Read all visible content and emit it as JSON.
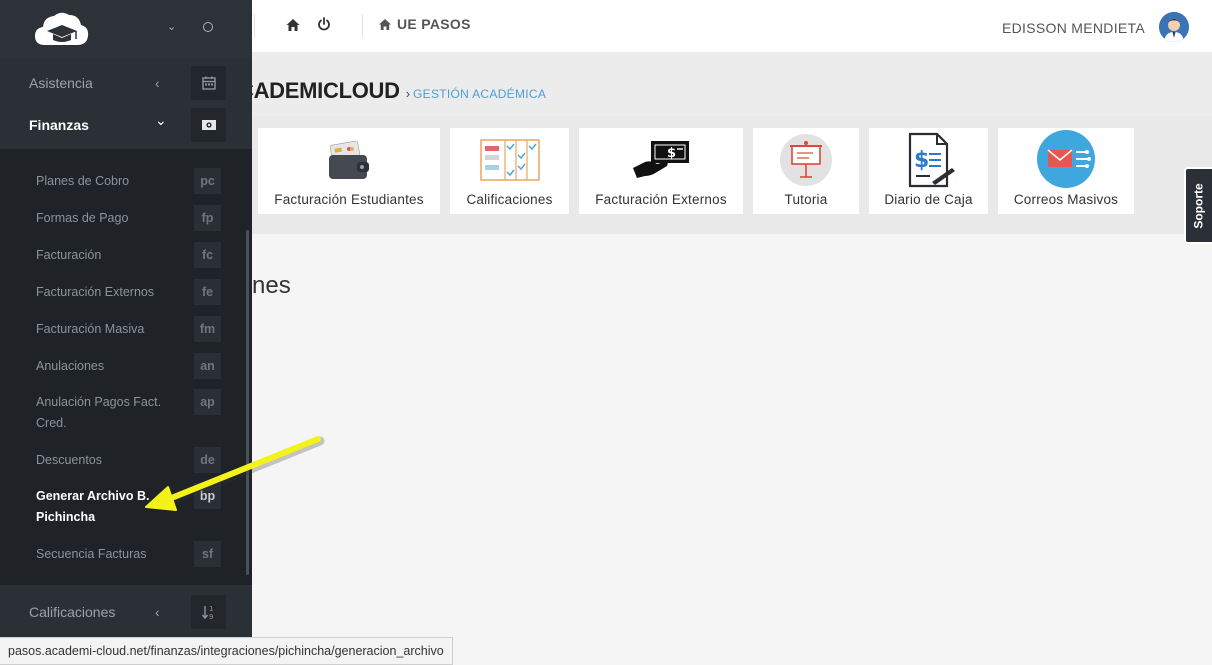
{
  "header": {
    "school_name": "UE PASOS",
    "user_name": "EDISSON MENDIETA",
    "home_icon": "home-icon",
    "power_icon": "power-icon"
  },
  "page": {
    "title": "ACADEMICLOUD",
    "title_visible": "CADEMICLOUD",
    "breadcrumb_sep": "›",
    "breadcrumb": "GESTIÓN ACADÉMICA",
    "section_text": "nes",
    "tiles": [
      {
        "label": "Facturación Estudiantes",
        "icon": "wallet-icon"
      },
      {
        "label": "Calificaciones",
        "icon": "checklist-icon"
      },
      {
        "label": "Facturación Externos",
        "icon": "cash-hand-icon"
      },
      {
        "label": "Tutoria",
        "icon": "presentation-icon"
      },
      {
        "label": "Diario de Caja",
        "icon": "invoice-icon"
      },
      {
        "label": "Correos Masivos",
        "icon": "email-icon"
      }
    ]
  },
  "soporte": "Soporte",
  "sidebar": {
    "top_items": [
      {
        "label": "Asistencia",
        "arrow": "‹",
        "icon": "calendar-icon"
      },
      {
        "label": "Finanzas",
        "arrow": "⌄",
        "icon": "money-icon"
      },
      {
        "label": "Calificaciones",
        "arrow": "‹",
        "icon": "sort-numeric-icon"
      }
    ],
    "sub_items": [
      {
        "label": "Planes de Cobro",
        "code": "pc"
      },
      {
        "label": "Formas de Pago",
        "code": "fp"
      },
      {
        "label": "Facturación",
        "code": "fc"
      },
      {
        "label": "Facturación Externos",
        "code": "fe"
      },
      {
        "label": "Facturación Masiva",
        "code": "fm"
      },
      {
        "label": "Anulaciones",
        "code": "an"
      },
      {
        "label": "Anulación Pagos Fact. Cred.",
        "code": "ap"
      },
      {
        "label": "Descuentos",
        "code": "de"
      },
      {
        "label": "Generar Archivo B. Pichincha",
        "code": "bp"
      },
      {
        "label": "Secuencia Facturas",
        "code": "sf"
      }
    ]
  },
  "status_url": "pasos.academi-cloud.net/finanzas/integraciones/pichincha/generacion_archivo",
  "colors": {
    "sidebar": "#2b3036",
    "submenu": "#1f2328",
    "accent": "#4a9fd8",
    "annotation_arrow": "#f3f31a"
  }
}
